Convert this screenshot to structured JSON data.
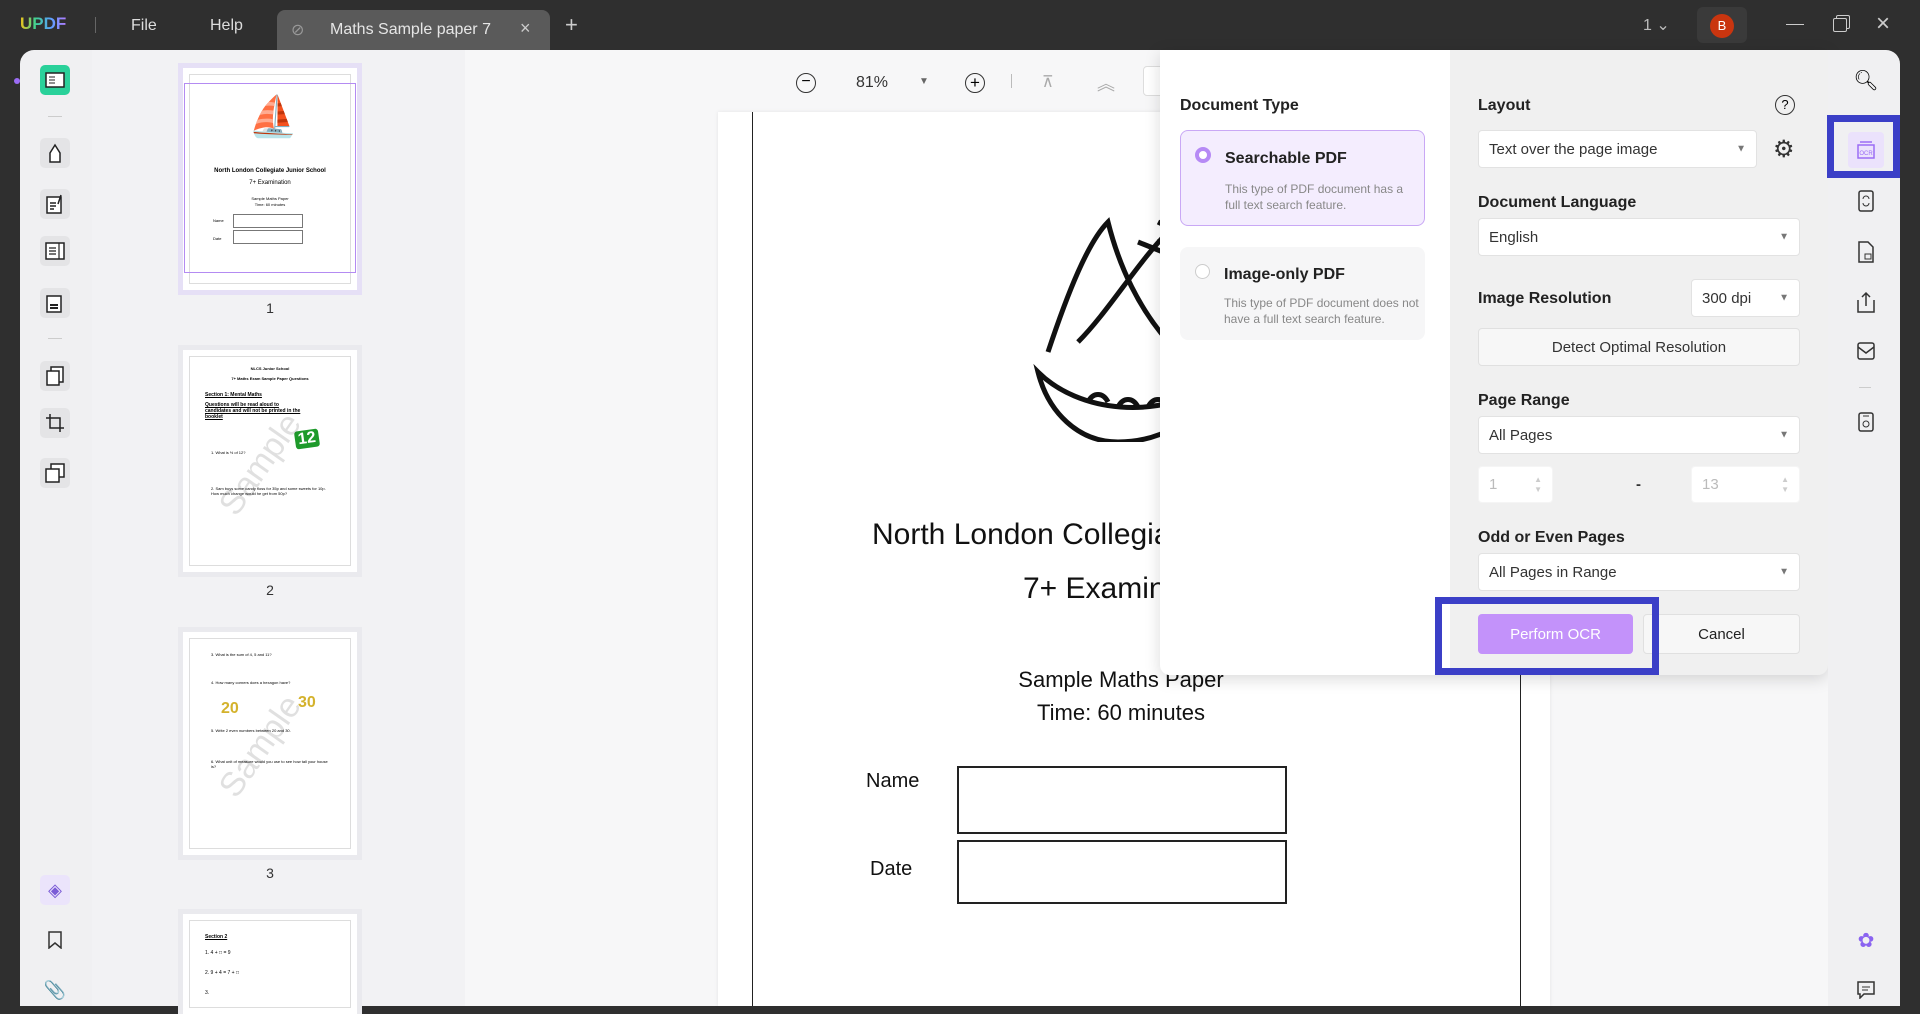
{
  "titlebar": {
    "logo": "UPDF",
    "menu": [
      "File",
      "Help"
    ],
    "tab": "Maths Sample paper 7",
    "page_count": "1",
    "avatar": "B",
    "avatar_color": "#c9350f"
  },
  "toolbar": {
    "zoom": "81%"
  },
  "thumbnails": [
    {
      "label": "1"
    },
    {
      "label": "2"
    },
    {
      "label": "3"
    }
  ],
  "thumb1": {
    "title": "North London Collegiate Junior School",
    "sub": "7+ Examination",
    "l1": "Sample Maths Paper",
    "l2": "Time: 60 minutes",
    "name": "Name",
    "date": "Date"
  },
  "thumb2": {
    "h1": "NLCS Junior School",
    "h2": "7+ Maths Exam Sample Paper Questions",
    "sec": "Section 1: Mental Maths",
    "note": "Questions will be read aloud to candidates and will not be printed in the booklet",
    "q1": "1. What is ½ of 12?",
    "q2": "2. Sam buys some candy floss for 35p and some sweets for 10p. How much change would he get from 50p?",
    "num": "12",
    "wm": "Sample"
  },
  "thumb3": {
    "q3": "3. What is the sum of 4, 5 and 11?",
    "q4": "4. How many corners does a hexagon have?",
    "q5": "5. Write 2 even numbers between 20 and 30.",
    "q6": "6. What unit of measure would you use to see how tall your house is?",
    "n1": "20",
    "n2": "30",
    "wm": "Sample"
  },
  "thumb4": {
    "sec": "Section 2",
    "e1": "1.   4 + □ = 9",
    "e2": "2.   9 + 4 = 7 + □",
    "e3": "3."
  },
  "page": {
    "title": "North London Collegia",
    "sub": "7+ Examin",
    "l1": "Sample Maths Paper",
    "l2": "Time: 60 minutes",
    "name": "Name",
    "date": "Date"
  },
  "ocr": {
    "doc_type_label": "Document Type",
    "searchable": {
      "title": "Searchable PDF",
      "desc": "This type of PDF document has a full text search feature."
    },
    "image_only": {
      "title": "Image-only PDF",
      "desc": "This type of PDF document does not have a full text search feature."
    },
    "layout_label": "Layout",
    "layout_value": "Text over the page image",
    "lang_label": "Document Language",
    "lang_value": "English",
    "res_label": "Image Resolution",
    "res_value": "300 dpi",
    "detect": "Detect Optimal Resolution",
    "range_label": "Page Range",
    "range_value": "All Pages",
    "from": "1",
    "dash": "-",
    "to": "13",
    "odd_label": "Odd or Even Pages",
    "odd_value": "All Pages in Range",
    "perform": "Perform OCR",
    "cancel": "Cancel",
    "accent": "#c392fa",
    "highlight": "#3b3fc7"
  }
}
